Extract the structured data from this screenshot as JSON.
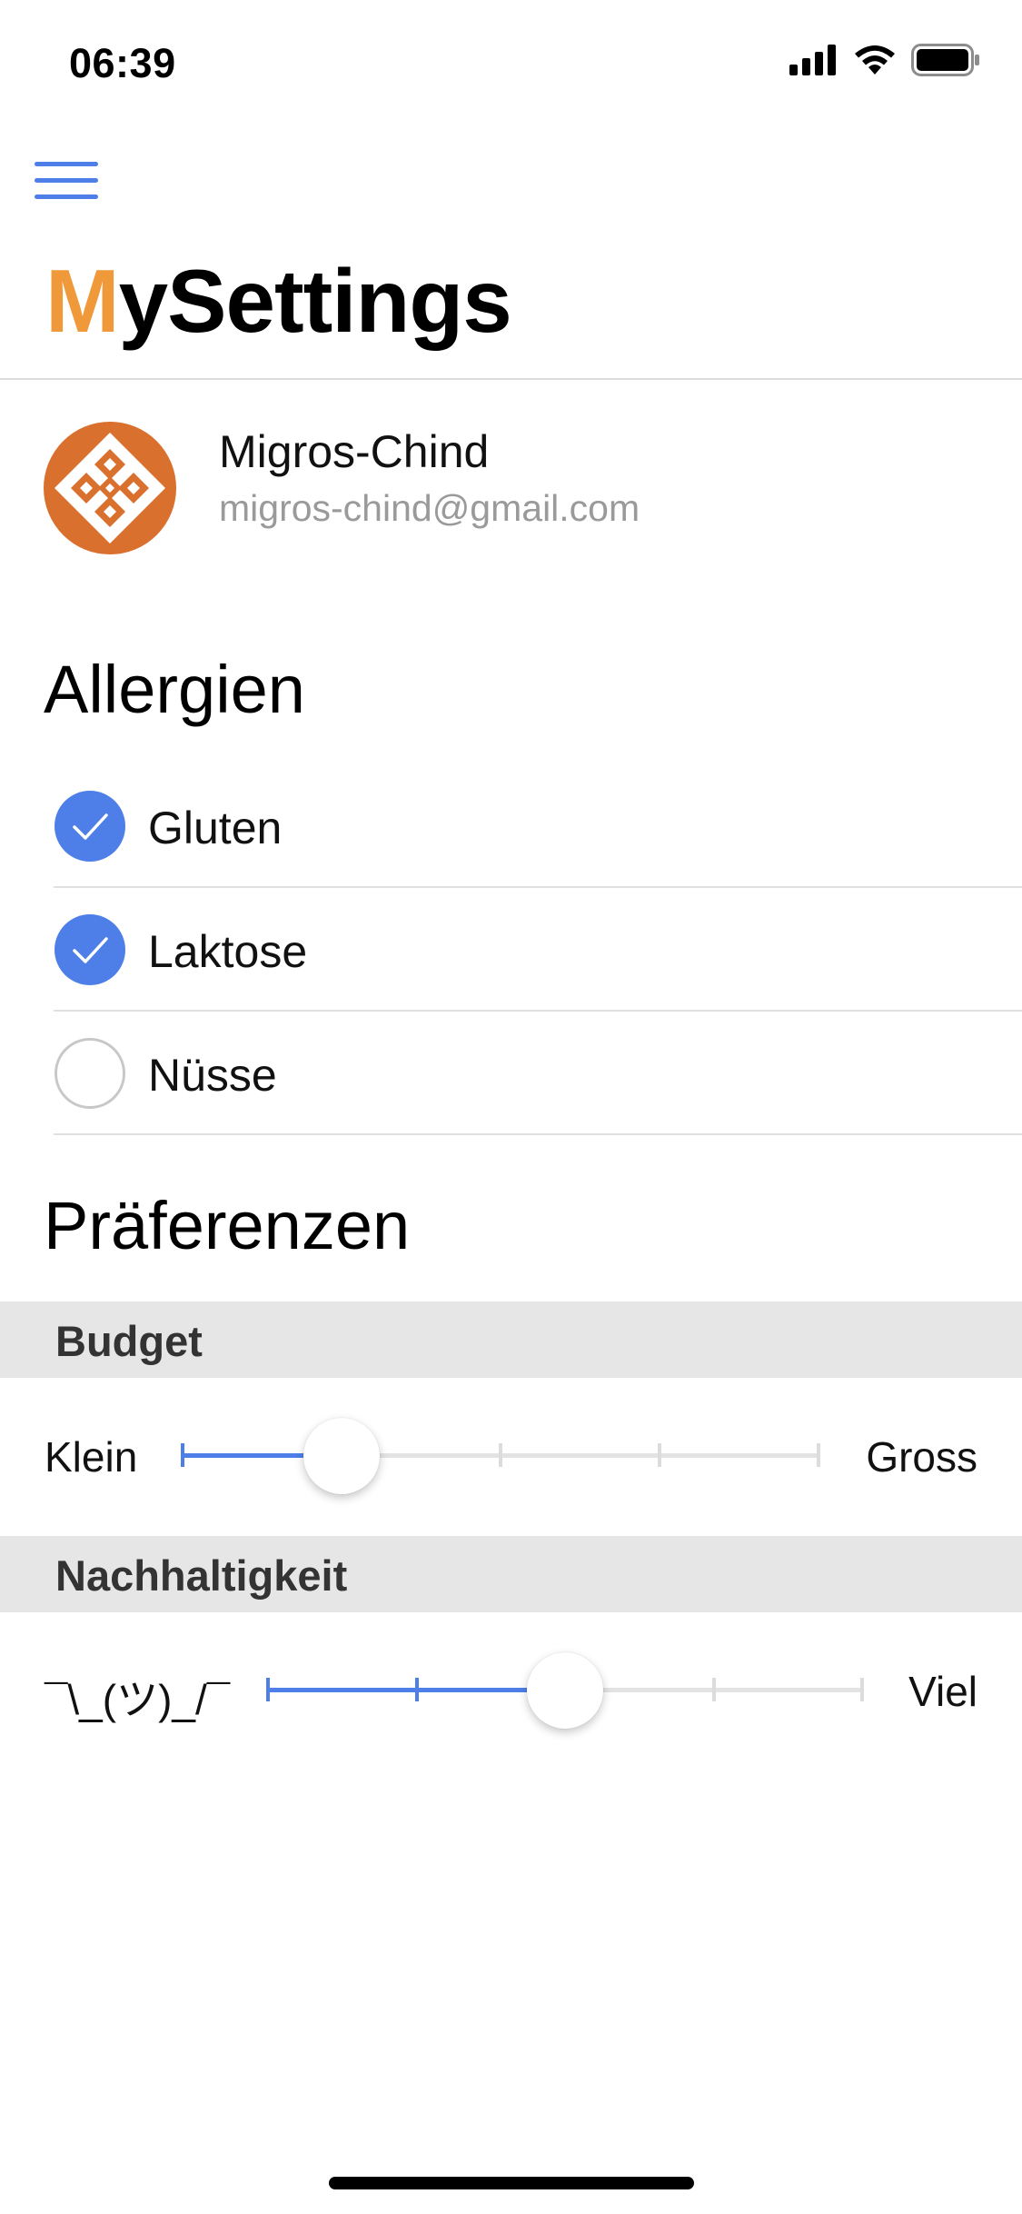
{
  "status_bar": {
    "time": "06:39",
    "icons": [
      "signal-icon",
      "wifi-icon",
      "battery-icon"
    ]
  },
  "header": {
    "menu_icon": "hamburger-menu-icon",
    "title_first_letter": "M",
    "title_rest": "ySettings",
    "accent_color": "#f0993a"
  },
  "profile": {
    "name": "Migros-Chind",
    "email": "migros-chind@gmail.com",
    "avatar_icon": "avatar-pattern-icon"
  },
  "allergies": {
    "heading": "Allergien",
    "items": [
      {
        "label": "Gluten",
        "checked": true
      },
      {
        "label": "Laktose",
        "checked": true
      },
      {
        "label": "Nüsse",
        "checked": false
      }
    ]
  },
  "preferences": {
    "heading": "Präferenzen",
    "budget": {
      "title": "Budget",
      "min_label": "Klein",
      "max_label": "Gross",
      "steps": 5,
      "value_fraction": 0.25
    },
    "sustainability": {
      "title": "Nachhaltigkeit",
      "min_label": "¯\\_(ツ)_/¯",
      "max_label": "Viel",
      "steps": 5,
      "value_fraction": 0.5
    }
  },
  "colors": {
    "accent_blue": "#4e7fe8",
    "accent_orange": "#f0993a",
    "avatar_orange": "#d9702e"
  }
}
